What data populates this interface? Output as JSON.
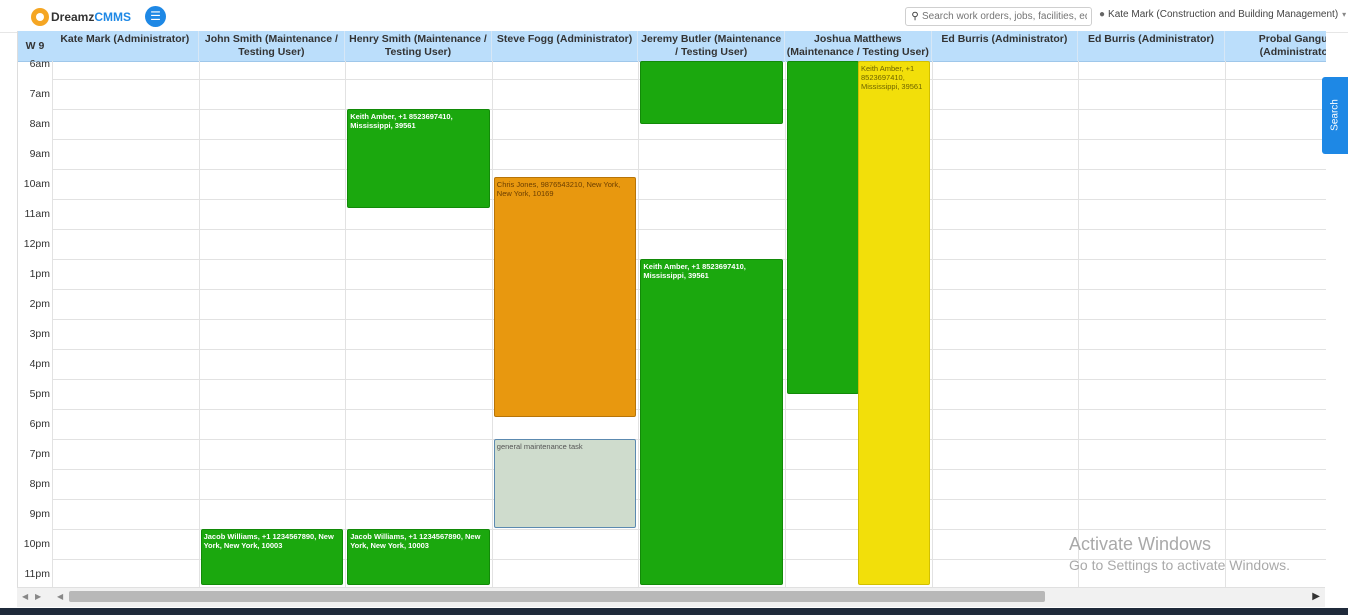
{
  "app": {
    "brand_dreamz": "Dreamz",
    "brand_cmms": "CMMS"
  },
  "topbar": {
    "menu_icon": "hamburger-icon",
    "search_placeholder": "Search work orders, jobs, facilities, equ",
    "user_label": "Kate Mark (Construction and Building Management)"
  },
  "calendar": {
    "week_label": "W 9",
    "columns": [
      "Kate Mark (Administrator)",
      "John Smith (Maintenance / Testing User)",
      "Henry Smith (Maintenance / Testing User)",
      "Steve Fogg (Administrator)",
      "Jeremy Butler (Maintenance / Testing User)",
      "Joshua Matthews (Maintenance / Testing User)",
      "Ed Burris (Administrator)",
      "Ed Burris (Administrator)",
      "Probal Ganguly (Administrator)"
    ],
    "times": [
      "6am",
      "7am",
      "8am",
      "9am",
      "10am",
      "11am",
      "12pm",
      "1pm",
      "2pm",
      "3pm",
      "4pm",
      "5pm",
      "6pm",
      "7pm",
      "8pm",
      "9pm",
      "10pm",
      "11pm"
    ],
    "events": [
      {
        "column": 2,
        "start_hour": 8.0,
        "end_hour": 11.3,
        "color": "green",
        "text": "Keith Amber, +1 8523697410, Mississippi, 39561"
      },
      {
        "column": 3,
        "start_hour": 10.25,
        "end_hour": 18.25,
        "color": "orange",
        "text": "Chris Jones, 9876543210, New York, New York, 10169"
      },
      {
        "column": 3,
        "start_hour": 19.0,
        "end_hour": 21.95,
        "color": "grey",
        "text": "general maintenance task"
      },
      {
        "column": 4,
        "start_hour": 5.95,
        "end_hour": 8.5,
        "color": "green",
        "text": ""
      },
      {
        "column": 4,
        "start_hour": 13.0,
        "end_hour": 24.0,
        "color": "green",
        "text": "Keith Amber, +1 8523697410, Mississippi, 39561"
      },
      {
        "column": 5,
        "start_hour": 5.95,
        "end_hour": 17.5,
        "color": "green",
        "text": ""
      },
      {
        "column": 5,
        "start_hour": 6.2,
        "end_hour": 24.0,
        "color": "yellow",
        "text": "Keith Amber, +1 8523697410, Mississippi, 39561",
        "sub": true
      },
      {
        "column": 1,
        "start_hour": 22.0,
        "end_hour": 24.0,
        "color": "green",
        "text": "Jacob Williams, +1 1234567890, New York, New York, 10003"
      },
      {
        "column": 2,
        "start_hour": 22.0,
        "end_hour": 24.0,
        "color": "green",
        "text": "Jacob Williams, +1 1234567890, New York, New York, 10003"
      }
    ]
  },
  "side_search": {
    "label": "Search"
  },
  "watermark": {
    "line1": "Activate Windows",
    "line2": "Go to Settings to activate Windows."
  }
}
